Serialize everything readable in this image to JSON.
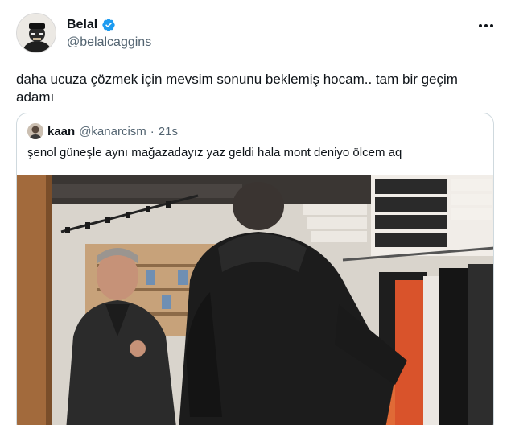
{
  "tweet": {
    "display_name": "Belal",
    "handle": "@belalcaggins",
    "text": "daha ucuza çözmek için mevsim sonunu beklemiş hocam.. tam bir geçim adamı"
  },
  "quoted_tweet": {
    "display_name": "kaan",
    "handle": "@kanarcism",
    "separator": "·",
    "time": "21s",
    "text": "şenol güneşle aynı mağazadayız yaz geldi hala mont deniyo ölcem aq"
  },
  "icons": {
    "verified": "verified-badge-icon",
    "more": "more-options-icon"
  },
  "colors": {
    "verified_blue": "#1d9bf0",
    "secondary_text": "#536471",
    "border": "#cfd9de"
  }
}
